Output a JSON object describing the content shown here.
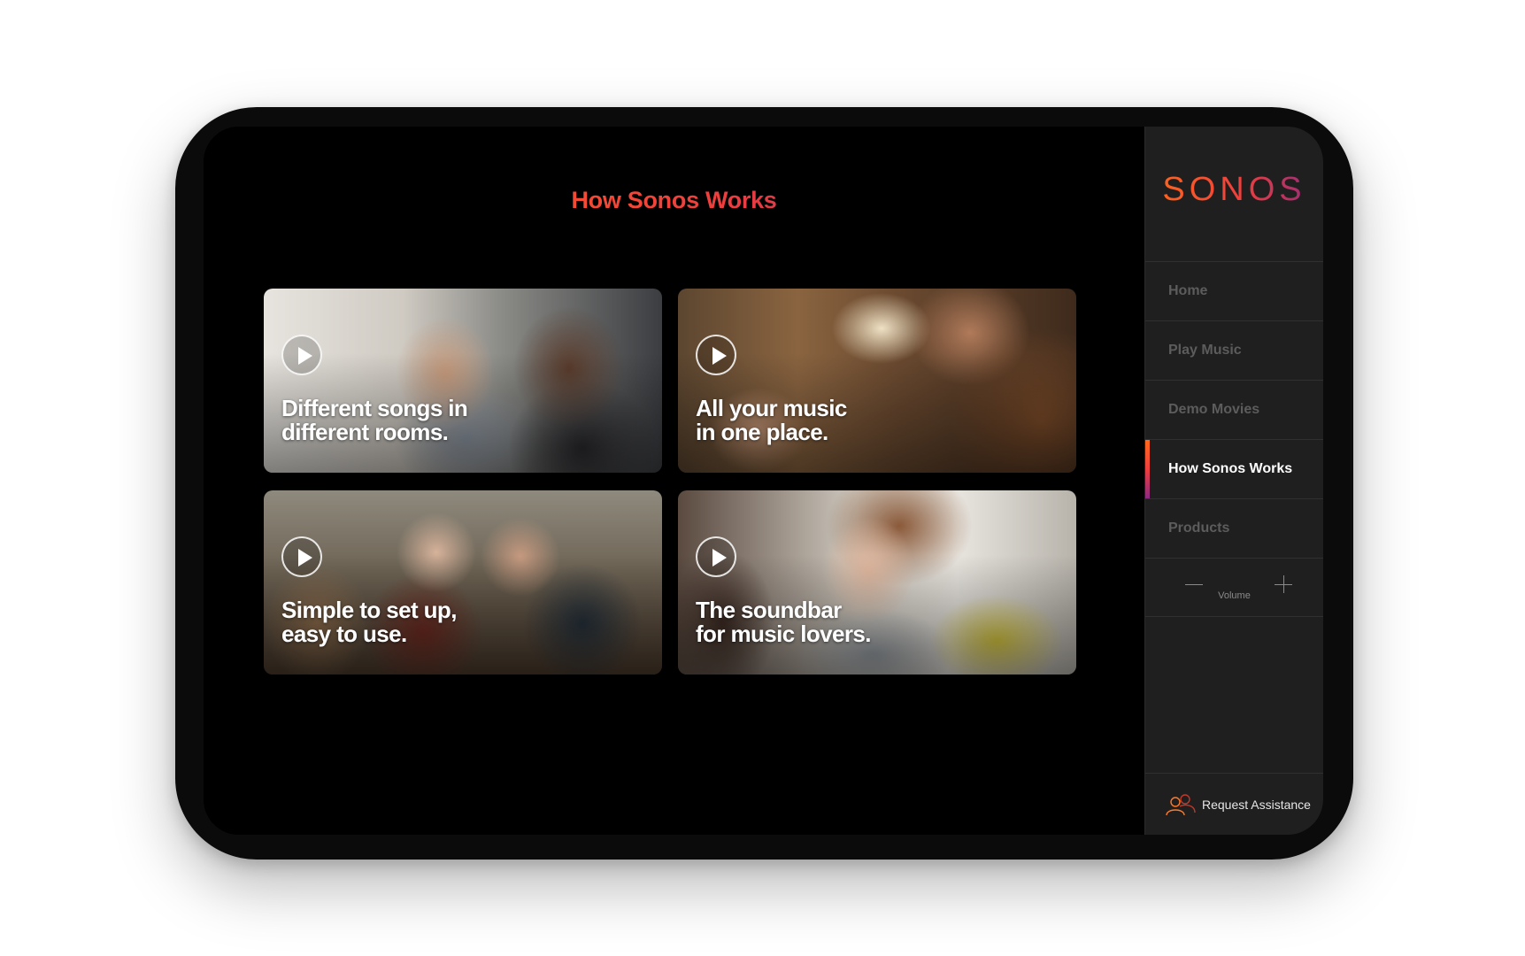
{
  "main": {
    "title": "How Sonos Works",
    "videos": [
      {
        "line1": "Different songs in",
        "line2": "different rooms."
      },
      {
        "line1": "All your music",
        "line2": "in one place."
      },
      {
        "line1": "Simple to set up,",
        "line2": "easy to use."
      },
      {
        "line1": "The soundbar",
        "line2": "for music lovers."
      }
    ]
  },
  "sidebar": {
    "logo": "SONOS",
    "items": [
      {
        "label": "Home",
        "active": false
      },
      {
        "label": "Play Music",
        "active": false
      },
      {
        "label": "Demo Movies",
        "active": false
      },
      {
        "label": "How Sonos Works",
        "active": true
      },
      {
        "label": "Products",
        "active": false
      }
    ],
    "volume_label": "Volume",
    "assist_label": "Request Assistance"
  },
  "colors": {
    "brand_orange": "#ff6a1a",
    "brand_red": "#ee3e3e",
    "brand_purple": "#8a2a82",
    "sidebar_bg": "#1f1f1f",
    "inactive_text": "#5c5c5c"
  },
  "icons": {
    "play": "play-circle-icon",
    "assist": "people-assist-icon",
    "volume_down": "minus-icon",
    "volume_up": "plus-icon"
  }
}
